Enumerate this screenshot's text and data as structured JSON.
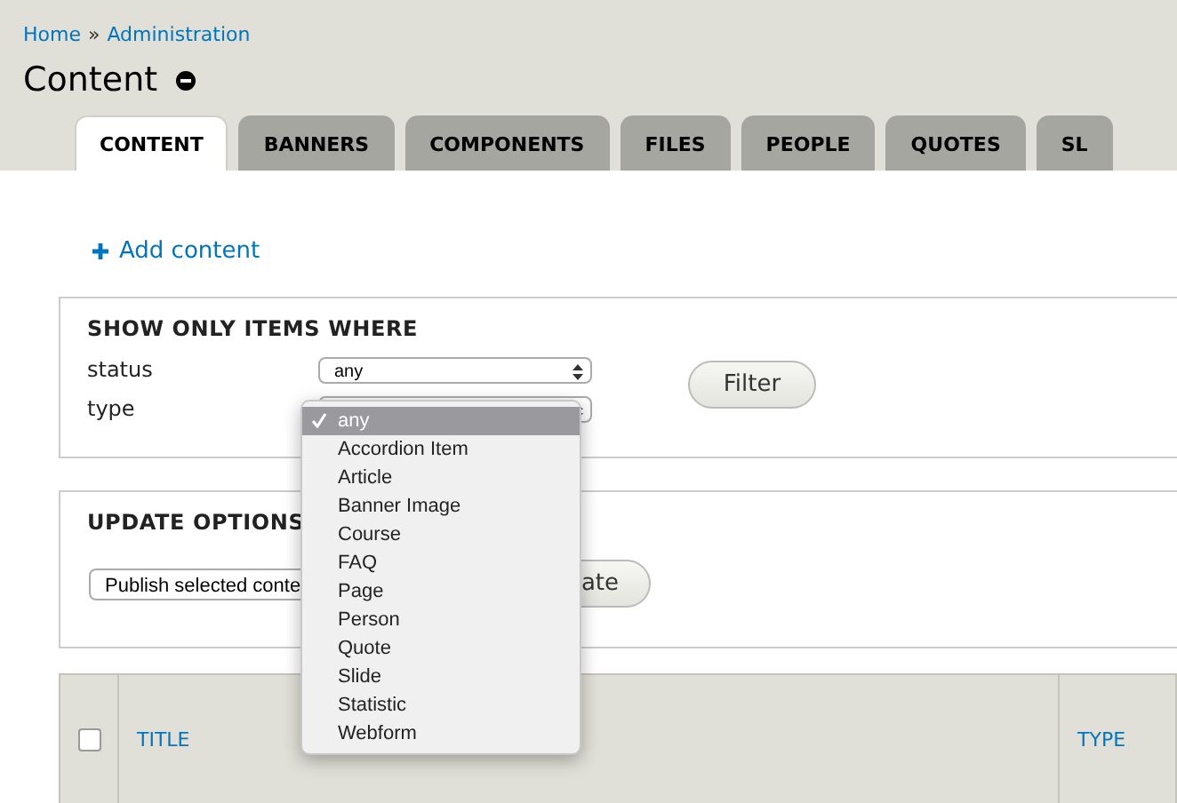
{
  "breadcrumb": [
    {
      "label": "Home"
    },
    {
      "label": "Administration"
    }
  ],
  "breadcrumb_separator": "»",
  "page_title": "Content",
  "tabs": [
    {
      "label": "CONTENT",
      "selected": true
    },
    {
      "label": "BANNERS",
      "selected": false
    },
    {
      "label": "COMPONENTS",
      "selected": false
    },
    {
      "label": "FILES",
      "selected": false
    },
    {
      "label": "PEOPLE",
      "selected": false
    },
    {
      "label": "QUOTES",
      "selected": false
    },
    {
      "label": "SL",
      "selected": false
    }
  ],
  "add_content": "Add content",
  "filter": {
    "legend": "SHOW ONLY ITEMS WHERE",
    "fields": [
      {
        "label": "status",
        "value": "any"
      },
      {
        "label": "type"
      }
    ],
    "button": "Filter"
  },
  "dropdown": {
    "items": [
      {
        "label": "any",
        "selected": true
      },
      {
        "label": "Accordion Item",
        "selected": false
      },
      {
        "label": "Article",
        "selected": false
      },
      {
        "label": "Banner Image",
        "selected": false
      },
      {
        "label": "Course",
        "selected": false
      },
      {
        "label": "FAQ",
        "selected": false
      },
      {
        "label": "Page",
        "selected": false
      },
      {
        "label": "Person",
        "selected": false
      },
      {
        "label": "Quote",
        "selected": false
      },
      {
        "label": "Slide",
        "selected": false
      },
      {
        "label": "Statistic",
        "selected": false
      },
      {
        "label": "Webform",
        "selected": false
      }
    ]
  },
  "update": {
    "legend": "UPDATE OPTIONS",
    "select_value": "Publish selected conte",
    "button": "ate"
  },
  "table": {
    "columns": [
      {
        "label": "TITLE"
      },
      {
        "label": "TYPE"
      }
    ],
    "select_all_checked": false
  }
}
